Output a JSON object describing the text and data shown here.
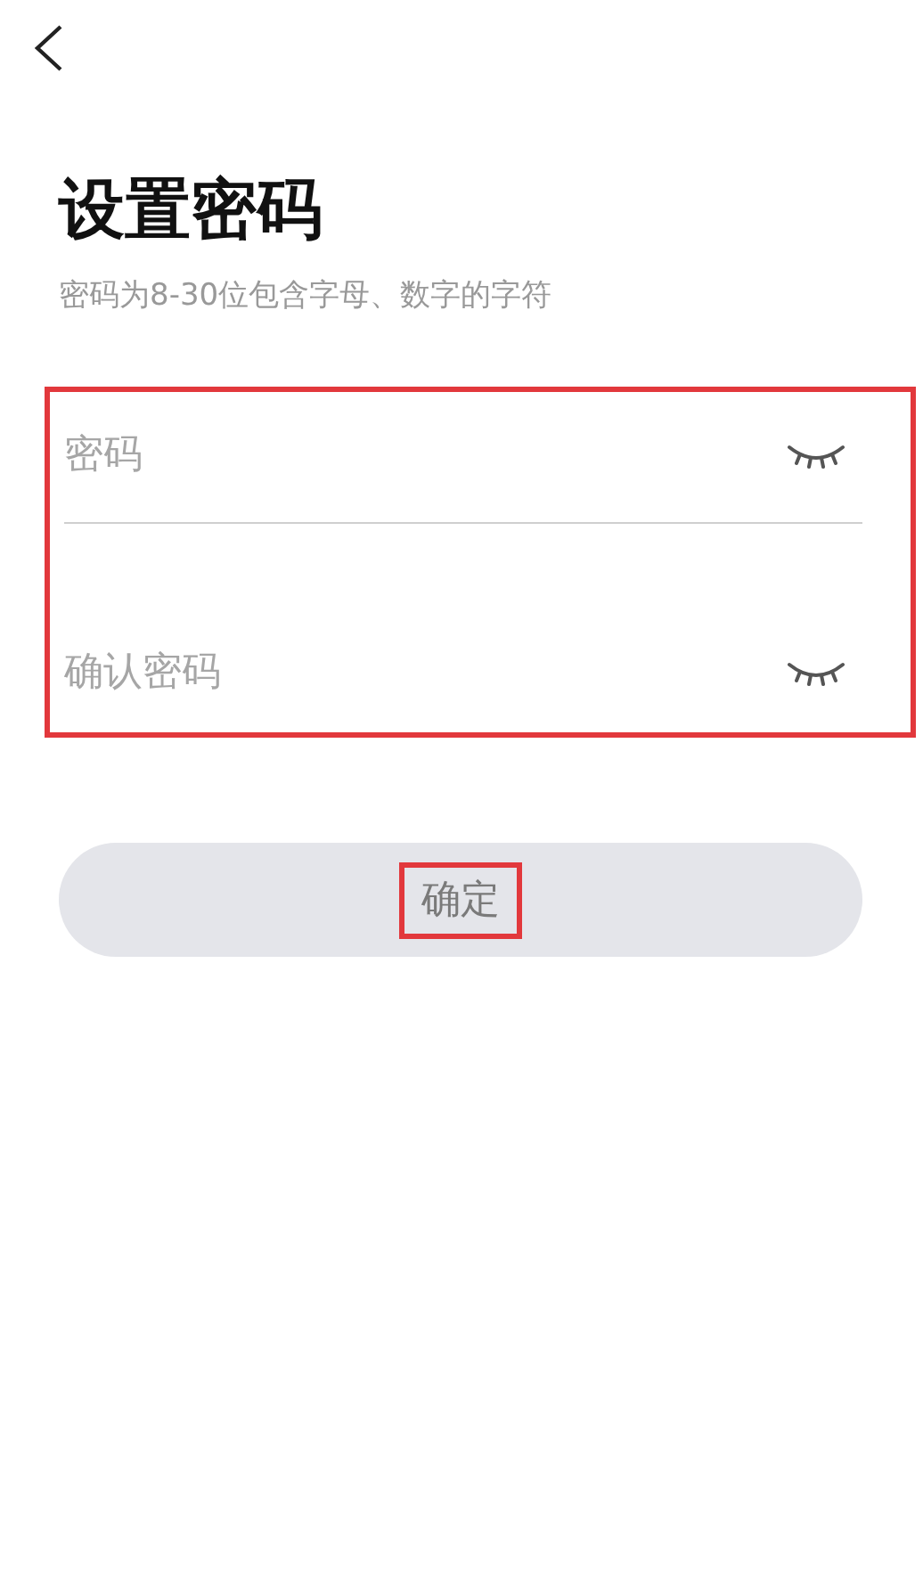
{
  "title": "设置密码",
  "subtitle": "密码为8-30位包含字母、数字的字符",
  "fields": [
    {
      "placeholder": "密码",
      "visible": false
    },
    {
      "placeholder": "确认密码",
      "visible": false
    }
  ],
  "fields_highlighted": true,
  "confirm_button": {
    "label": "确定",
    "disabled": true,
    "highlighted": true
  }
}
